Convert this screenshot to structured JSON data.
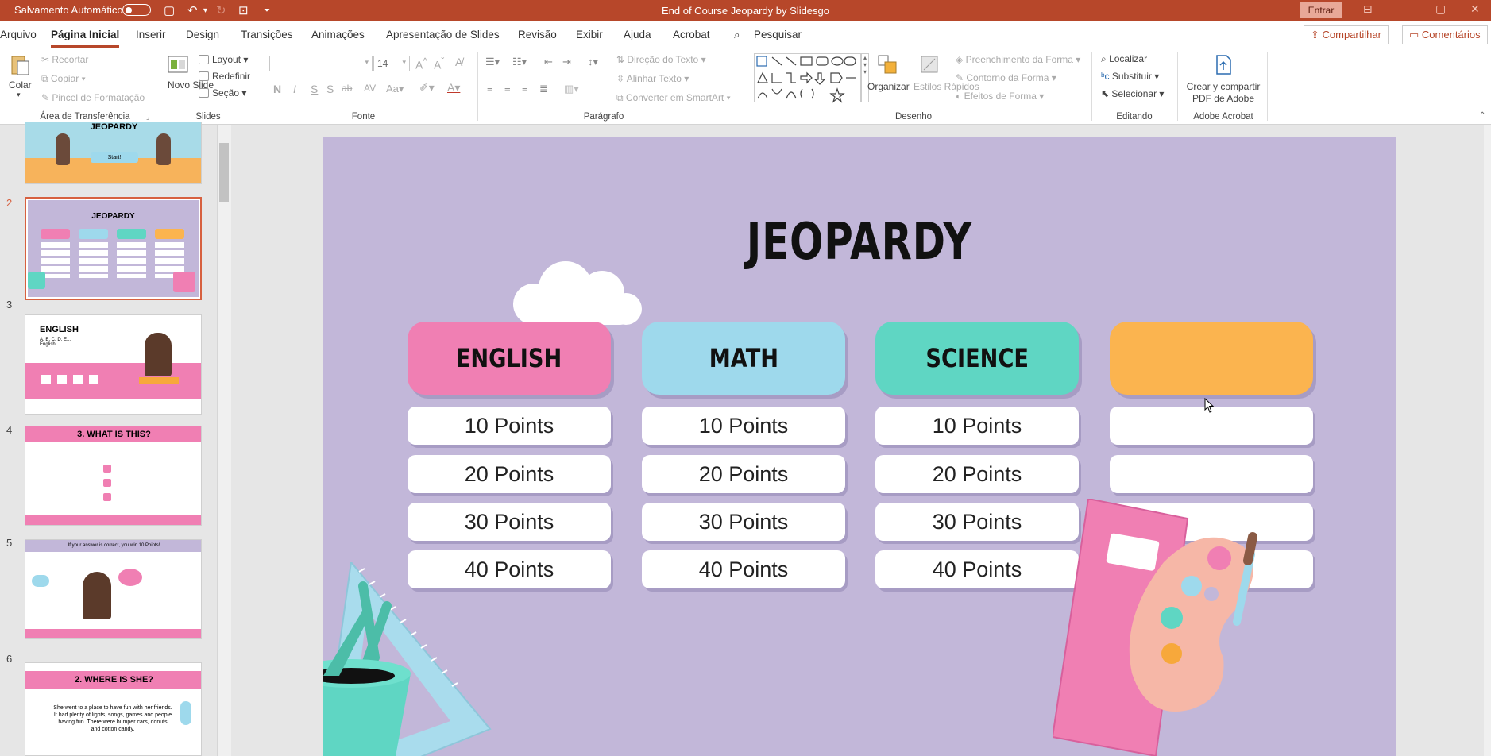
{
  "titlebar": {
    "autosave_label": "Salvamento Automático",
    "doc_title": "End of Course Jeopardy by Slidesgo",
    "signin": "Entrar"
  },
  "tabs": [
    {
      "label": "Arquivo"
    },
    {
      "label": "Página Inicial",
      "active": true
    },
    {
      "label": "Inserir"
    },
    {
      "label": "Design"
    },
    {
      "label": "Transições"
    },
    {
      "label": "Animações"
    },
    {
      "label": "Apresentação de Slides"
    },
    {
      "label": "Revisão"
    },
    {
      "label": "Exibir"
    },
    {
      "label": "Ajuda"
    },
    {
      "label": "Acrobat"
    }
  ],
  "search_label": "Pesquisar",
  "share_label": "Compartilhar",
  "comments_label": "Comentários",
  "ribbon": {
    "clipboard": {
      "paste": "Colar",
      "cut": "Recortar",
      "copy": "Copiar",
      "format_painter": "Pincel de Formatação",
      "group": "Área de Transferência"
    },
    "slides": {
      "new_slide": "Novo Slide",
      "layout": "Layout",
      "reset": "Redefinir",
      "section": "Seção",
      "group": "Slides"
    },
    "font": {
      "font_size": "14",
      "group": "Fonte"
    },
    "paragraph": {
      "text_direction": "Direção do Texto",
      "align_text": "Alinhar Texto",
      "smartart": "Converter em SmartArt",
      "group": "Parágrafo"
    },
    "drawing": {
      "arrange": "Organizar",
      "quick_styles": "Estilos Rápidos",
      "shape_fill": "Preenchimento da Forma",
      "shape_outline": "Contorno da Forma",
      "shape_effects": "Efeitos de Forma",
      "group": "Desenho"
    },
    "editing": {
      "find": "Localizar",
      "replace": "Substituir",
      "select": "Selecionar",
      "group": "Editando"
    },
    "acrobat": {
      "create_share": "Crear y compartir PDF de Adobe",
      "group": "Adobe Acrobat"
    }
  },
  "thumbnails": [
    {
      "num": "2",
      "title": "JEOPARDY"
    },
    {
      "num": "3",
      "title": "ENGLISH",
      "sub": "A, B, C, D, E...\nEnglish!"
    },
    {
      "num": "4",
      "title": "3. WHAT IS THIS?"
    },
    {
      "num": "5",
      "title": "If your answer is correct, you win 10 Points!"
    },
    {
      "num": "6",
      "title": "2. WHERE IS SHE?",
      "body": "She went to a place to have fun with her friends. It had plenty of lights, songs, games and people having fun. There were bumper cars, donuts and cotton candy."
    }
  ],
  "thumb1_title": "JEOPARDY",
  "thumb1_button": "Start!",
  "slide": {
    "title": "JEOPARDY",
    "categories": [
      {
        "name": "ENGLISH",
        "color": "#f07fb3"
      },
      {
        "name": "MATH",
        "color": "#9ed9ec"
      },
      {
        "name": "SCIENCE",
        "color": "#5fd6c3"
      },
      {
        "name": "",
        "color": "#fbb44f"
      }
    ],
    "points": [
      "10 Points",
      "20 Points",
      "30 Points",
      "40 Points"
    ]
  }
}
